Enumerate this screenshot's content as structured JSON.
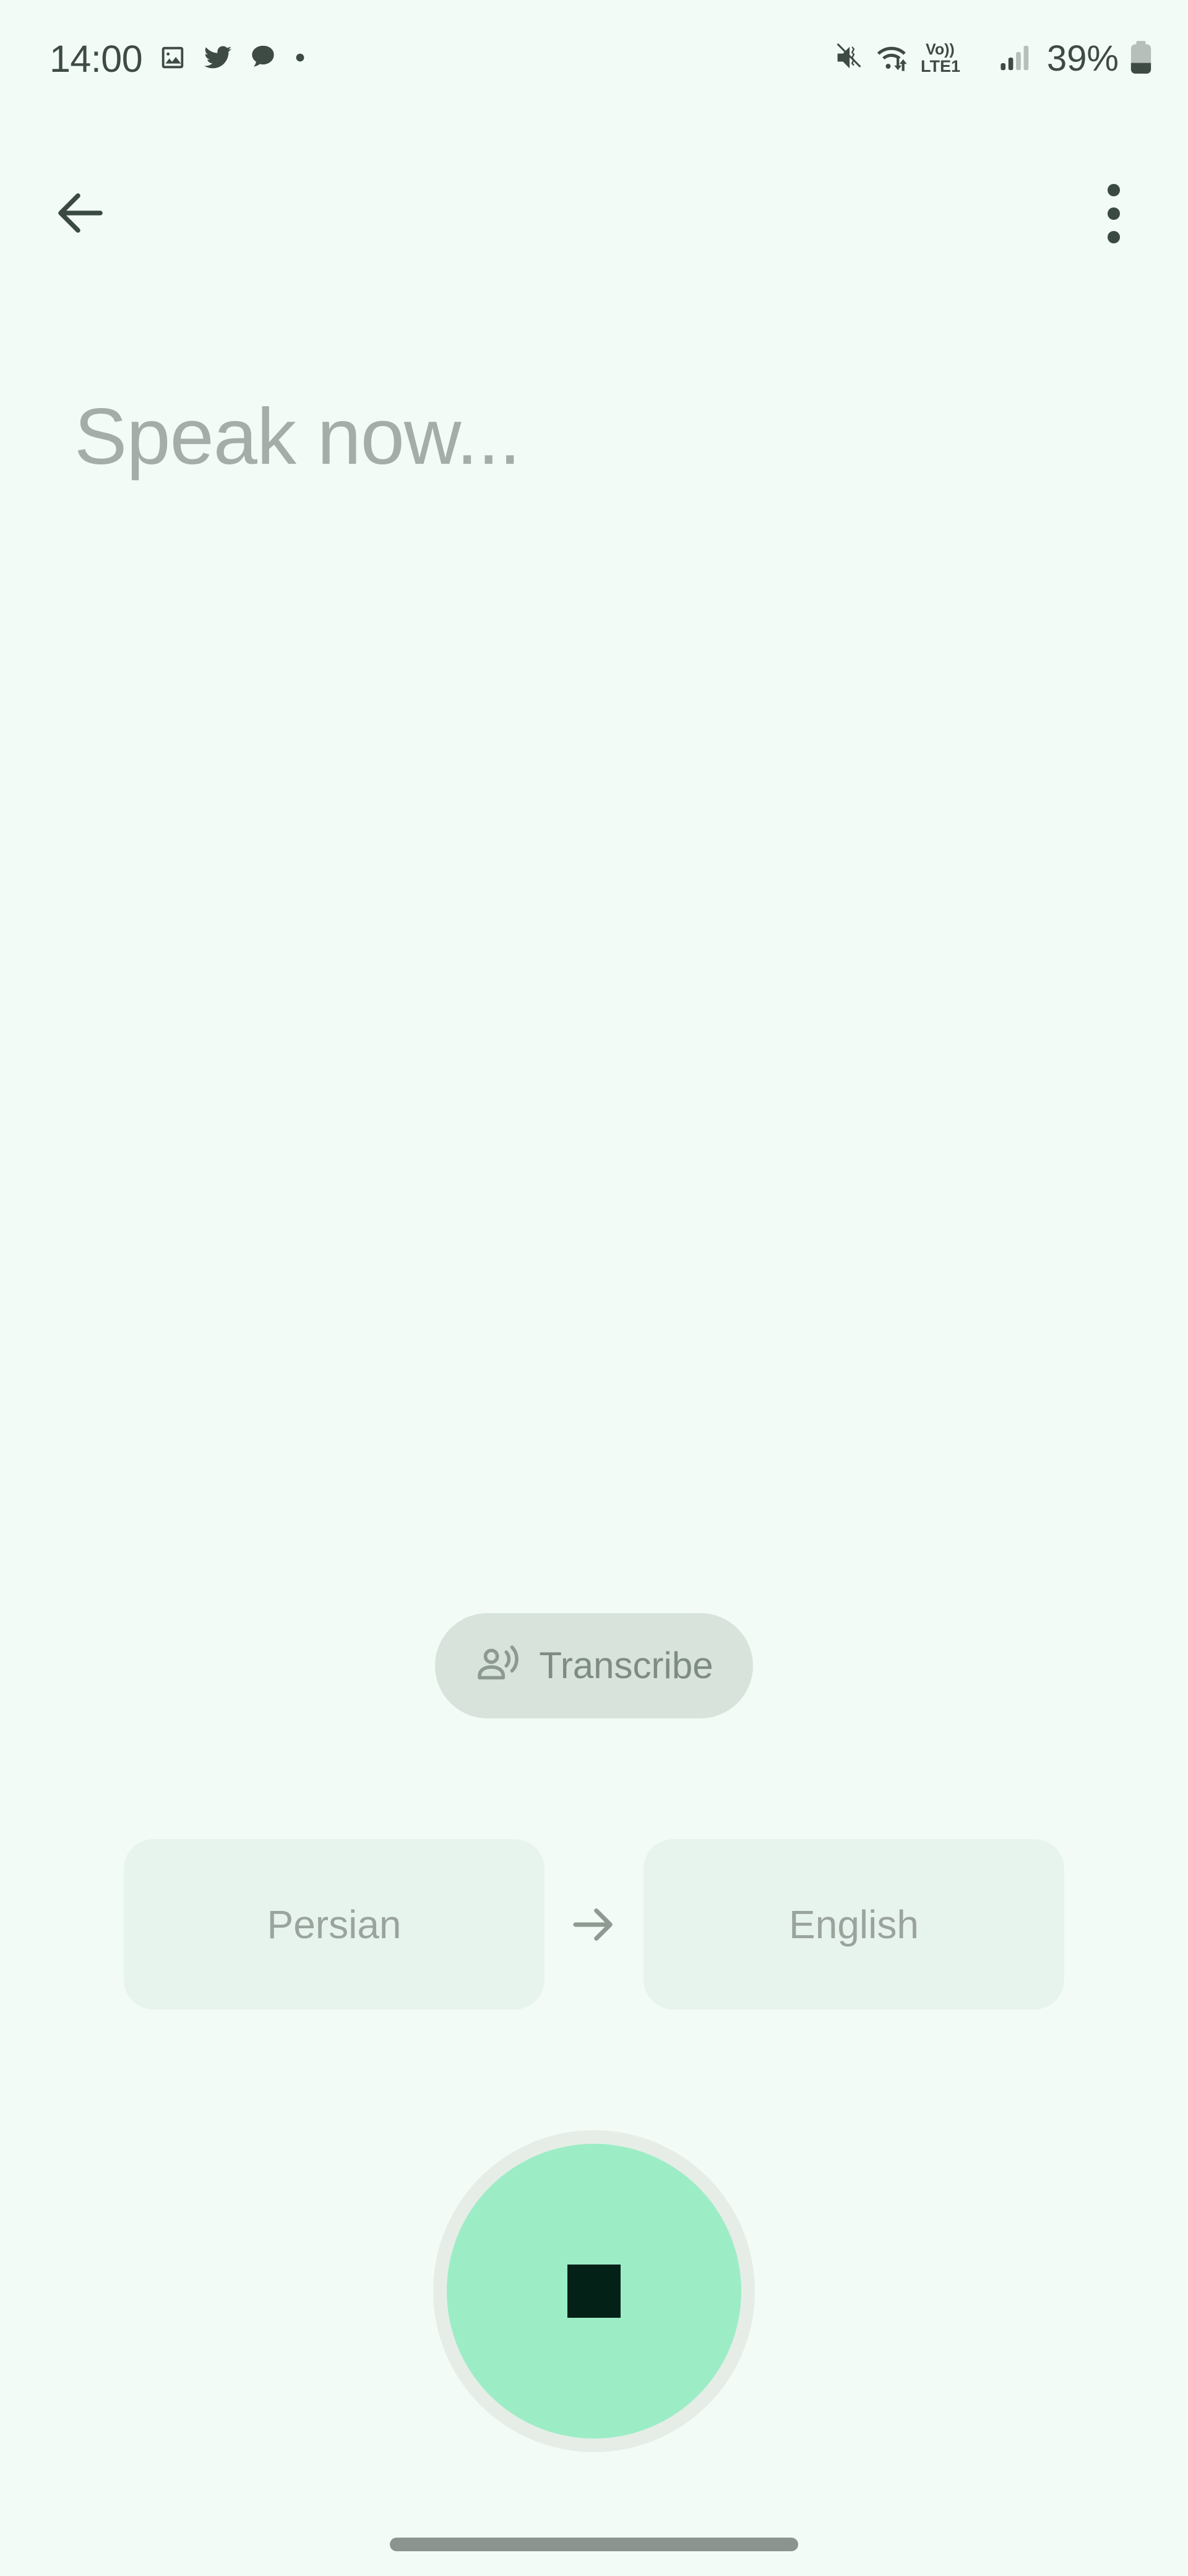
{
  "theme": {
    "background": "#F3FBF6",
    "on_surface": "#3E4B44",
    "muted_text": "#9AA49D",
    "placeholder_text": "#A4ADA7",
    "pill_background": "#D7E3DB",
    "chip_background": "#E7F4ED",
    "accent_mint": "#9CEDC6",
    "accent_dark": "#042118",
    "ring": "#E6EDE7",
    "home_indicator": "#8C9490"
  },
  "status_bar": {
    "time": "14:00",
    "notification_icons": [
      "image-icon",
      "twitter-icon",
      "chat-bubble-icon",
      "dot-icon"
    ],
    "ringer_icon": "mute-vibrate-icon",
    "wifi_icon": "wifi-data-transfer-icon",
    "network_label_top": "Vo))",
    "network_label_bottom": "LTE1",
    "signal_icon": "signal-bars-icon",
    "battery_percent": "39%",
    "battery_icon": "battery-icon"
  },
  "app_bar": {
    "back_icon": "back-arrow-icon",
    "overflow_icon": "more-vertical-icon"
  },
  "transcript": {
    "placeholder": "Speak now..."
  },
  "transcribe_button": {
    "label": "Transcribe",
    "icon": "record-voice-over-icon"
  },
  "language_selector": {
    "source": "Persian",
    "target": "English",
    "direction_icon": "arrow-right-icon"
  },
  "record_button": {
    "state": "recording",
    "icon": "stop-square-icon"
  },
  "navigation": {
    "home_indicator": "home-indicator"
  }
}
